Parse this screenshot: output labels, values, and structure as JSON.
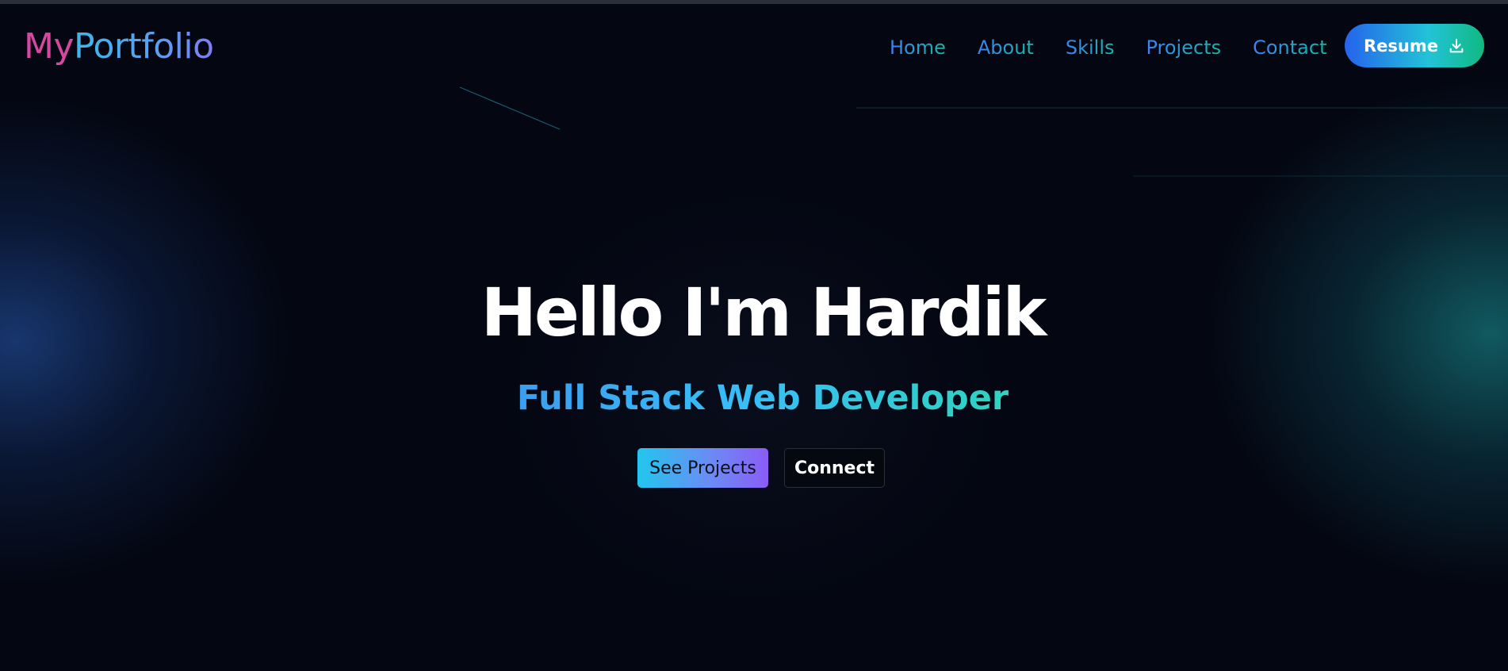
{
  "navbar": {
    "logo_part1": "My",
    "logo_part2": "Portfolio",
    "links": [
      {
        "label": "Home"
      },
      {
        "label": "About"
      },
      {
        "label": "Skills"
      },
      {
        "label": "Projects"
      },
      {
        "label": "Contact"
      }
    ],
    "resume_label": "Resume",
    "resume_icon": "download-icon"
  },
  "hero": {
    "title": "Hello I'm Hardik",
    "subtitle": "Full Stack Web Developer",
    "primary_button": "See Projects",
    "secondary_button": "Connect"
  },
  "colors": {
    "background": "#040712",
    "logo_my": "#d6479f",
    "accent_blue": "#3b82f6",
    "accent_teal": "#14b8a6",
    "button_cyan": "#22c6ee",
    "button_purple": "#8b5cf6"
  }
}
